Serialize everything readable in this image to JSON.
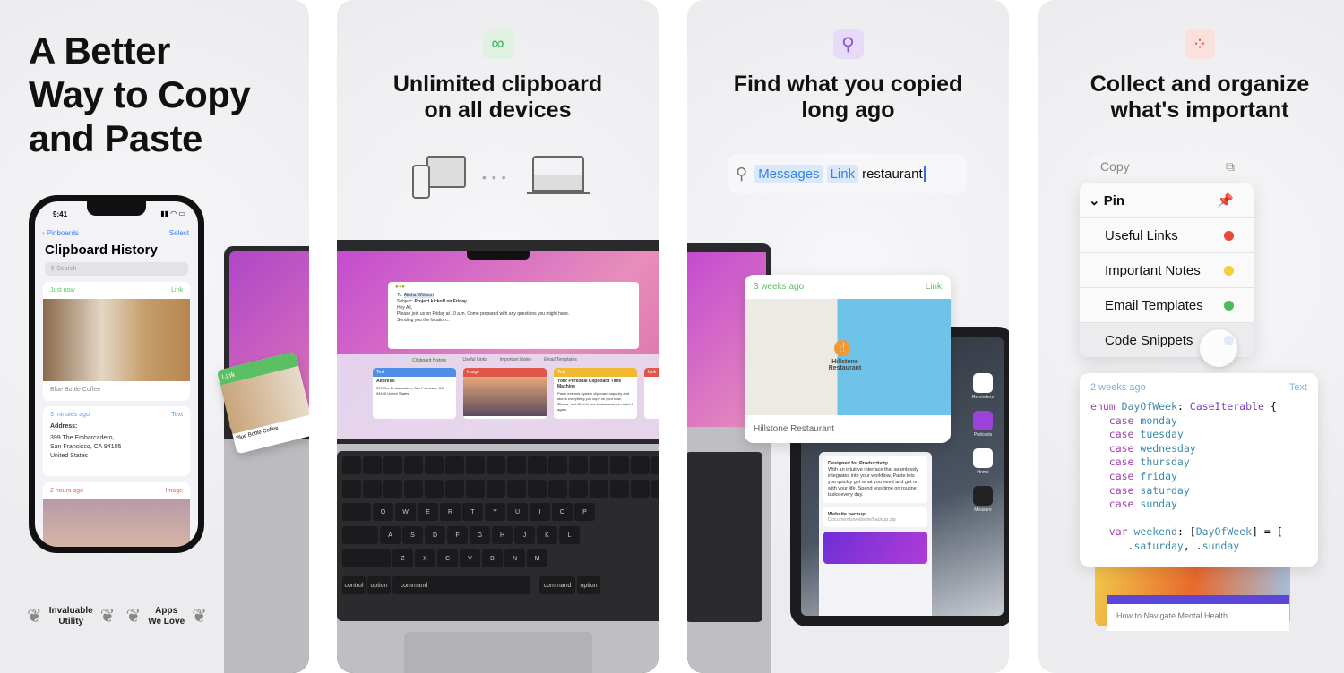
{
  "panel1": {
    "headline": [
      "A Better",
      "Way to Copy",
      "and Paste"
    ],
    "phone": {
      "time": "9:41",
      "back": "Pinboards",
      "select": "Select",
      "title": "Clipboard History",
      "search_placeholder": "Search",
      "cards": [
        {
          "time": "Just now",
          "type": "Link",
          "caption": "Blue Bottle Coffee",
          "color": "#5bbf63"
        },
        {
          "time": "3 minutes ago",
          "type": "Text",
          "heading": "Address:",
          "body": [
            "399 The Embarcadero,",
            "San Francisco, CA 94105",
            "United States"
          ],
          "color": "#5c9ce6"
        },
        {
          "time": "2 hours ago",
          "type": "Image",
          "color": "#e0675a"
        }
      ]
    },
    "side_card": {
      "type": "Link",
      "caption": "Blue Bottle Coffee"
    },
    "awards": [
      [
        "Invaluable",
        "Utility"
      ],
      [
        "Apps",
        "We Love"
      ]
    ]
  },
  "panel2": {
    "icon": "infinity-icon",
    "title": [
      "Unlimited clipboard",
      "on all devices"
    ],
    "mail": {
      "to": "Alisha Whitson",
      "subject": "Project kickoff on Friday",
      "body": [
        "Hey All,",
        "Please join us on Friday at 10 a.m. Come prepared with any questions you might have.",
        "Sending you the location..."
      ]
    },
    "tabs": [
      "Clipboard History",
      "Useful Links",
      "Important Notes",
      "Email Templates"
    ],
    "clips": [
      {
        "type": "Text",
        "title": "Address:",
        "body": "399 The Embarcadero, San Francisco, CA 94105 United States",
        "color": "#4f8fe8"
      },
      {
        "type": "Image",
        "color": "#e0564a"
      },
      {
        "type": "Text",
        "title": "Your Personal Clipboard Time Machine",
        "body": "Paste extends system clipboard capacity and stores everything you copy on your Mac, iPhone, and iPad to use it whenever you need it again.",
        "color": "#f0b72f"
      },
      {
        "type": "Link",
        "color": "#e0564a"
      }
    ],
    "keyboard": {
      "rows": [
        [
          "Q",
          "W",
          "E",
          "R",
          "T",
          "Y",
          "U",
          "I",
          "O",
          "P"
        ],
        [
          "A",
          "S",
          "D",
          "F",
          "G",
          "H",
          "J",
          "K",
          "L"
        ],
        [
          "Z",
          "X",
          "C",
          "V",
          "B",
          "N",
          "M"
        ]
      ],
      "mods": [
        "control",
        "option",
        "command",
        "command",
        "option"
      ]
    }
  },
  "panel3": {
    "icon": "search-icon",
    "title": [
      "Find what you copied",
      "long ago"
    ],
    "search": {
      "tokens": [
        "Messages",
        "Link"
      ],
      "query": "restaurant"
    },
    "result": {
      "time": "3 weeks ago",
      "type": "Link",
      "place": "Hillstone Restaurant",
      "pin_label": "Hillstone Restaurant"
    },
    "ipad": {
      "note_title": "Designed for Productivity",
      "note_body": "With an intuitive interface that seamlessly integrates into your workflow, Paste lets you quickly get what you need and get on with your life. Spend less time on routine tasks every day.",
      "file_title": "Website backup",
      "file_path": "Documents/website/backup.zip",
      "apps": [
        "Reminders",
        "Podcasts",
        "Home",
        "Measure"
      ]
    }
  },
  "panel4": {
    "icon": "grid-icon",
    "title": [
      "Collect and organize",
      "what's important"
    ],
    "menu": {
      "copy": "Copy",
      "pin": "Pin",
      "items": [
        {
          "label": "Useful Links",
          "color": "#e8483c"
        },
        {
          "label": "Important Notes",
          "color": "#f4cf3c"
        },
        {
          "label": "Email Templates",
          "color": "#4cbb5c"
        },
        {
          "label": "Code Snippets",
          "color": "#2f6fe8"
        }
      ]
    },
    "code_card": {
      "time": "2 weeks ago",
      "type": "Text",
      "lines": [
        [
          [
            "kw",
            "enum "
          ],
          [
            "id",
            "DayOfWeek"
          ],
          [
            "",
            ": "
          ],
          [
            "ty",
            "CaseIterable"
          ],
          [
            "",
            " {"
          ]
        ],
        [
          [
            "kw",
            "   case "
          ],
          [
            "id",
            "monday"
          ]
        ],
        [
          [
            "kw",
            "   case "
          ],
          [
            "id",
            "tuesday"
          ]
        ],
        [
          [
            "kw",
            "   case "
          ],
          [
            "id",
            "wednesday"
          ]
        ],
        [
          [
            "kw",
            "   case "
          ],
          [
            "id",
            "thursday"
          ]
        ],
        [
          [
            "kw",
            "   case "
          ],
          [
            "id",
            "friday"
          ]
        ],
        [
          [
            "kw",
            "   case "
          ],
          [
            "id",
            "saturday"
          ]
        ],
        [
          [
            "kw",
            "   case "
          ],
          [
            "id",
            "sunday"
          ]
        ],
        [
          [
            "",
            ""
          ]
        ],
        [
          [
            "kw",
            "   var "
          ],
          [
            "id",
            "weekend"
          ],
          [
            "",
            ": ["
          ],
          [
            "id",
            "DayOfWeek"
          ],
          [
            "",
            "] = ["
          ]
        ],
        [
          [
            "",
            "      ."
          ],
          [
            "id",
            "saturday"
          ],
          [
            "",
            ", ."
          ],
          [
            "id",
            "sunday"
          ]
        ]
      ]
    },
    "under_card": "How to Navigate Mental Health"
  }
}
